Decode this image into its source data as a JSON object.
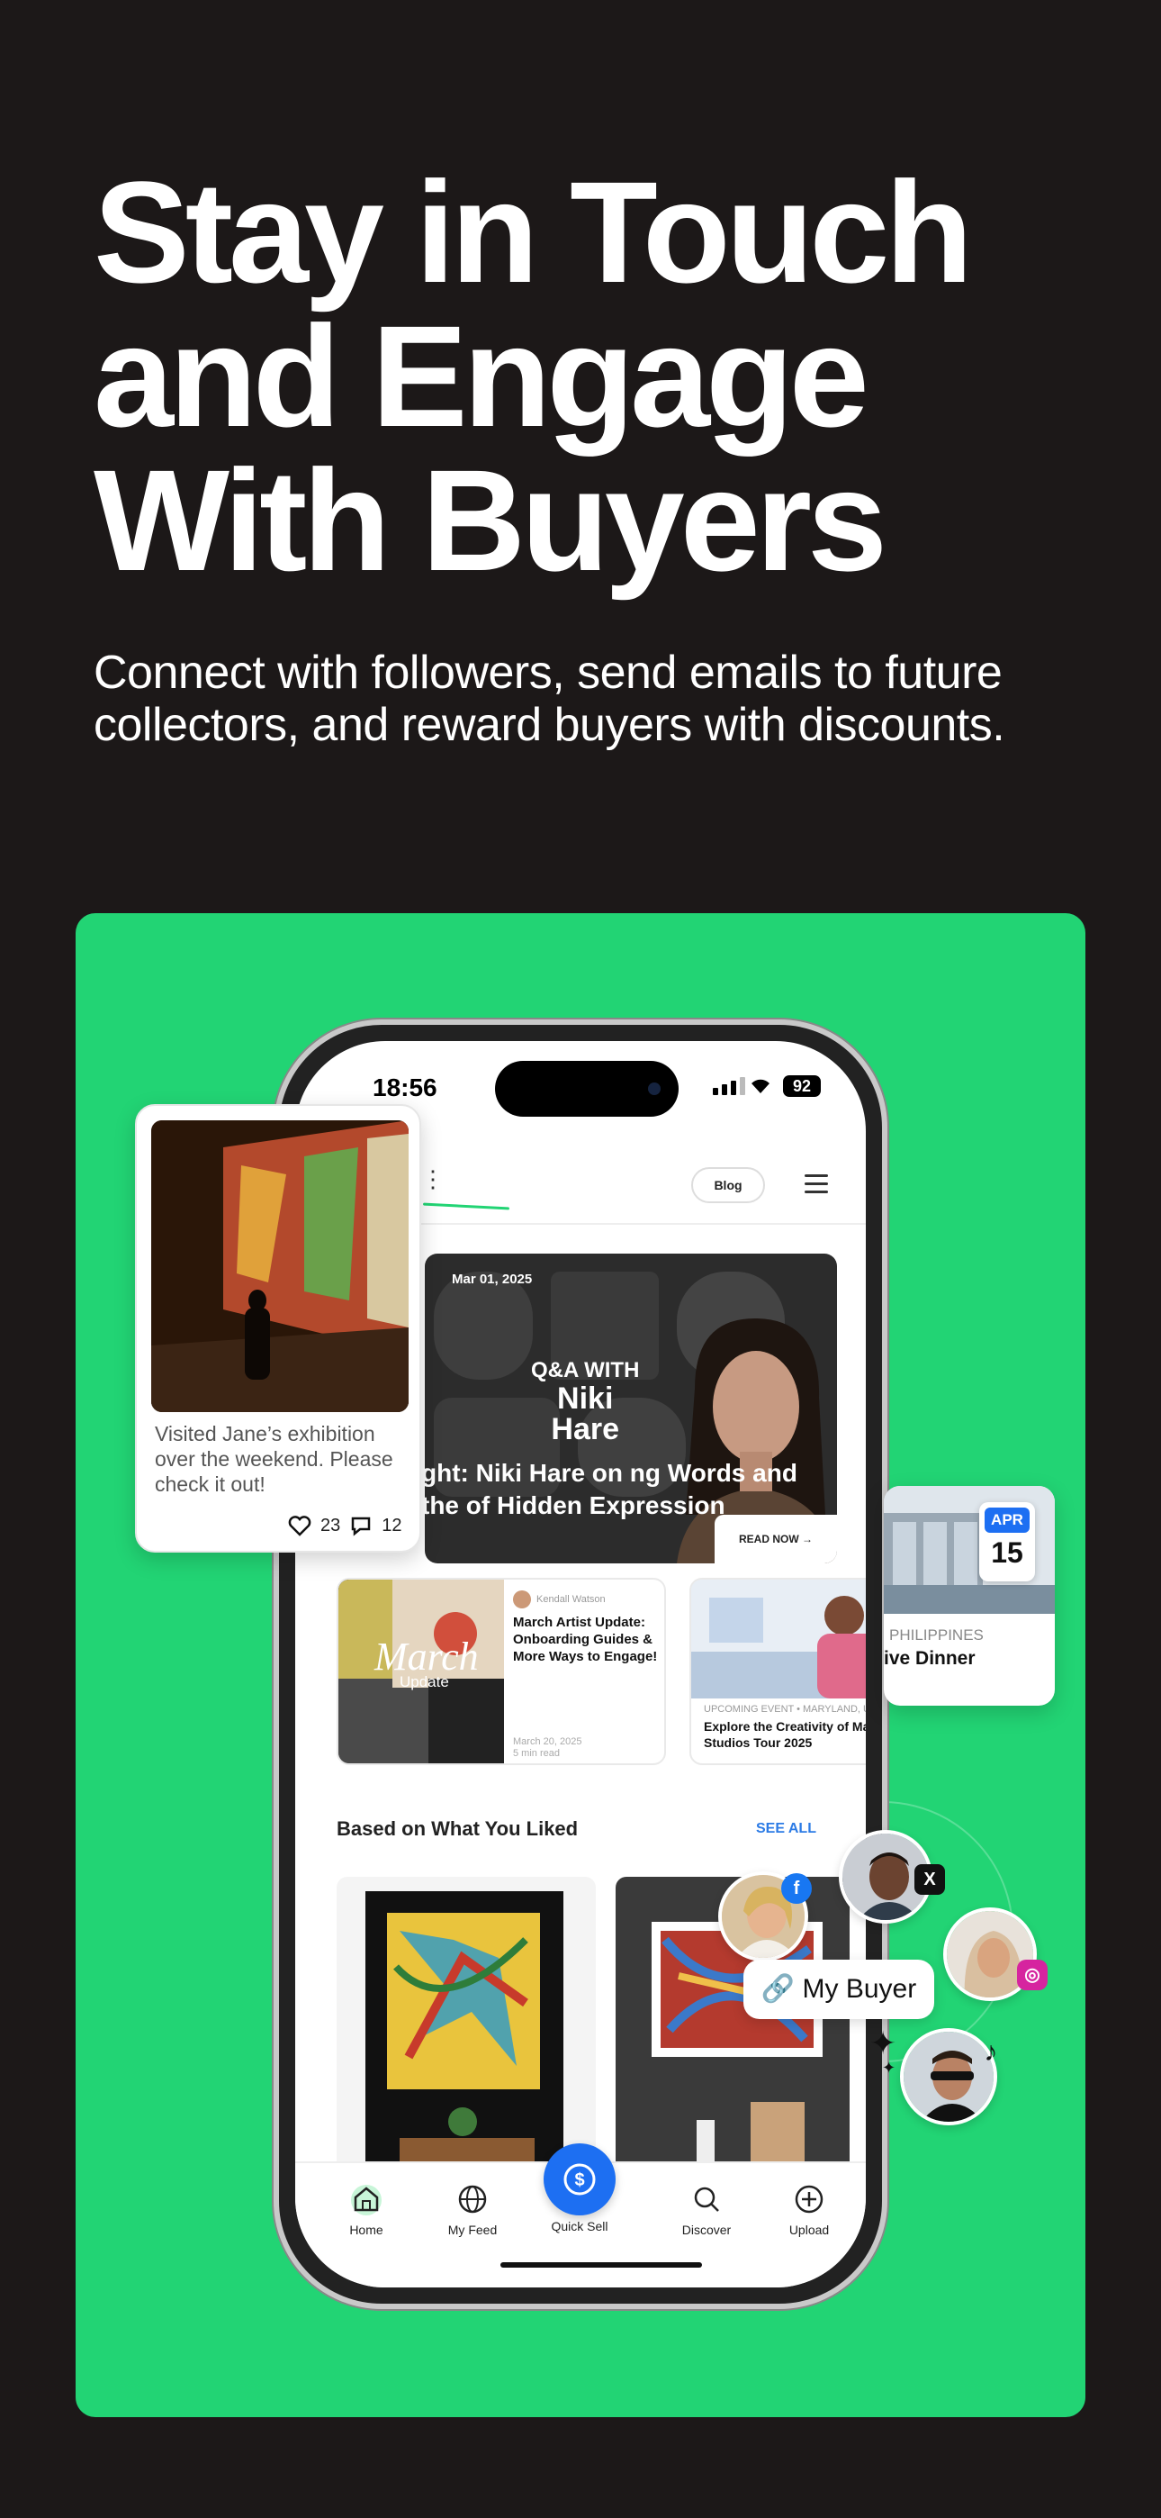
{
  "hero": {
    "title_line1": "Stay in Touch",
    "title_line2": "and Engage",
    "title_line3": "With Buyers",
    "subtitle": "Connect with followers, send emails to future collectors, and reward buyers with discounts."
  },
  "status_bar": {
    "time": "18:56",
    "battery": "92"
  },
  "app_bar": {
    "blog_label": "Blog"
  },
  "feature": {
    "date": "Mar 01, 2025",
    "qa_label": "Q&A WITH",
    "name_line1": "Niki",
    "name_line2": "Hare",
    "headline": "ght: Niki Hare on ng Words and the of Hidden Expression",
    "read_now": "READ NOW →"
  },
  "articles": [
    {
      "overlay_title": "March",
      "overlay_sub": "Update",
      "author": "Kendall Watson",
      "title": "March Artist Update: Onboarding Guides & More Ways to Engage!",
      "date": "March 20, 2025",
      "read_time": "5 min read"
    },
    {
      "meta": "UPCOMING EVENT • MARYLAND, U",
      "title": "Explore the Creativity of Ma Studios Tour 2025"
    }
  ],
  "recommendations": {
    "title": "Based on What You Liked",
    "see_all": "SEE ALL"
  },
  "bottom_nav": {
    "home": "Home",
    "feed": "My Feed",
    "sell": "Quick Sell",
    "discover": "Discover",
    "upload": "Upload"
  },
  "post": {
    "text": "Visited Jane’s exhibition over the weekend. Please check it out!",
    "likes": "23",
    "comments": "12"
  },
  "event": {
    "month": "APR",
    "day": "15",
    "location": "PHILIPPINES",
    "title": "ive Dinner"
  },
  "social": {
    "tag_label": "My Buyer",
    "networks": [
      "facebook-icon",
      "x-icon",
      "instagram-icon",
      "tiktok-icon"
    ]
  },
  "colors": {
    "background": "#1c1818",
    "accent_green": "#22d474",
    "primary_blue": "#1d6ff2",
    "link_blue": "#2c7be5"
  }
}
